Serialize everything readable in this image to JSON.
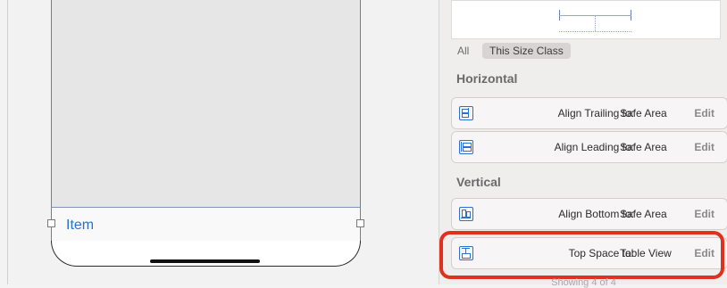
{
  "canvas": {
    "tab_item_label": "Item"
  },
  "inspector": {
    "size_tabs": {
      "all": "All",
      "this_size_class": "This Size Class",
      "selected": "This Size Class"
    },
    "sections": [
      {
        "title": "Horizontal",
        "constraints": [
          {
            "label": "Align Trailing to:",
            "target": "Safe Area",
            "edit": "Edit",
            "icon": "align-trailing-icon"
          },
          {
            "label": "Align Leading to:",
            "target": "Safe Area",
            "edit": "Edit",
            "icon": "align-leading-icon"
          }
        ]
      },
      {
        "title": "Vertical",
        "constraints": [
          {
            "label": "Align Bottom to:",
            "target": "Safe Area",
            "edit": "Edit",
            "icon": "align-bottom-icon"
          },
          {
            "label": "Top Space to:",
            "target": "Table View",
            "edit": "Edit",
            "icon": "top-space-icon",
            "highlighted": true
          }
        ]
      }
    ],
    "footer": "Showing 4 of 4"
  },
  "colors": {
    "highlight": "#e0301e",
    "accent": "#2e6fd0",
    "tab_item_text": "#2a72c8"
  }
}
